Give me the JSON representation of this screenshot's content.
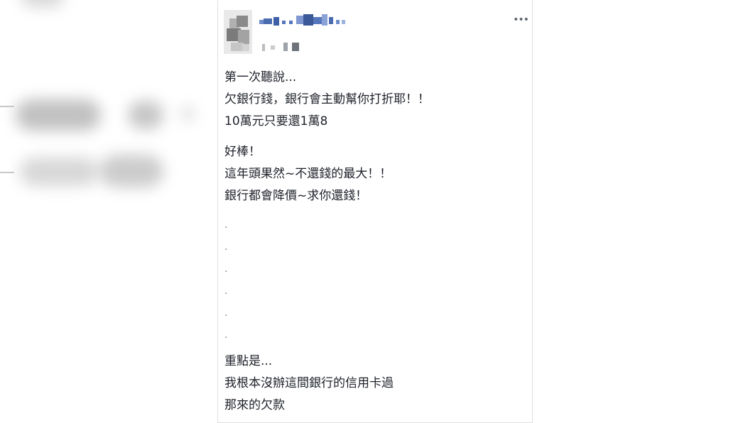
{
  "post": {
    "more_icon": "more-options-icon",
    "more_label": "•••",
    "paragraphs": [
      [
        "第一次聽說...",
        "欠銀行錢，銀行會主動幫你打折耶！！",
        "10萬元只要還1萬8"
      ],
      [
        "好棒！",
        "這年頭果然~不還錢的最大！！",
        "銀行都會降價~求你還錢！"
      ],
      [
        "重點是...",
        "我根本沒辦這間銀行的信用卡過",
        "那來的欠款"
      ]
    ],
    "dots": [
      ".",
      ".",
      ".",
      ".",
      ".",
      "."
    ]
  },
  "colors": {
    "text": "#1d2129",
    "author_blue": "#4267b2",
    "border": "#dddfe2",
    "meta_gray": "#90949c"
  }
}
